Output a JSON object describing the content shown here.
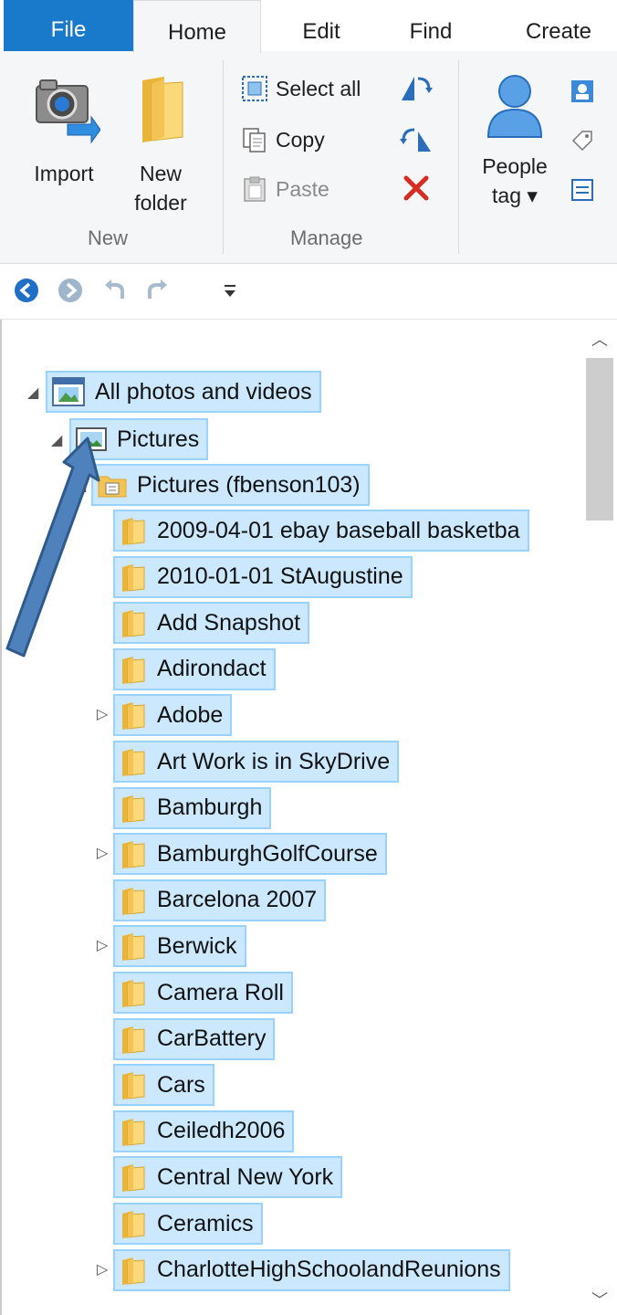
{
  "tabs": {
    "file": "File",
    "home": "Home",
    "edit": "Edit",
    "find": "Find",
    "create": "Create"
  },
  "ribbon": {
    "new_group": {
      "label": "New",
      "import": "Import",
      "new_folder_line1": "New",
      "new_folder_line2": "folder"
    },
    "manage_group": {
      "label": "Manage",
      "select_all": "Select all",
      "copy": "Copy",
      "paste": "Paste"
    },
    "people_tag_line1": "People",
    "people_tag_line2": "tag ▾"
  },
  "tree": {
    "root": "All photos and videos",
    "pictures": "Pictures",
    "account_folder": "Pictures (fbenson103)",
    "folders": [
      {
        "name": "2009-04-01 ebay baseball basketba",
        "expandable": false
      },
      {
        "name": "2010-01-01 StAugustine",
        "expandable": false
      },
      {
        "name": "Add Snapshot",
        "expandable": false
      },
      {
        "name": "Adirondact",
        "expandable": false
      },
      {
        "name": "Adobe",
        "expandable": true
      },
      {
        "name": "Art Work is in SkyDrive",
        "expandable": false
      },
      {
        "name": "Bamburgh",
        "expandable": false
      },
      {
        "name": "BamburghGolfCourse",
        "expandable": true
      },
      {
        "name": "Barcelona 2007",
        "expandable": false
      },
      {
        "name": "Berwick",
        "expandable": true
      },
      {
        "name": "Camera Roll",
        "expandable": false
      },
      {
        "name": "CarBattery",
        "expandable": false
      },
      {
        "name": "Cars",
        "expandable": false
      },
      {
        "name": "Ceiledh2006",
        "expandable": false
      },
      {
        "name": "Central New York",
        "expandable": false
      },
      {
        "name": "Ceramics",
        "expandable": false
      },
      {
        "name": "CharlotteHighSchoolandReunions",
        "expandable": true
      }
    ]
  },
  "colors": {
    "file_tab": "#1979ca",
    "selection_fill": "#cce8ff",
    "selection_border": "#99d1ff",
    "annotation_arrow": "#4f81bd"
  }
}
